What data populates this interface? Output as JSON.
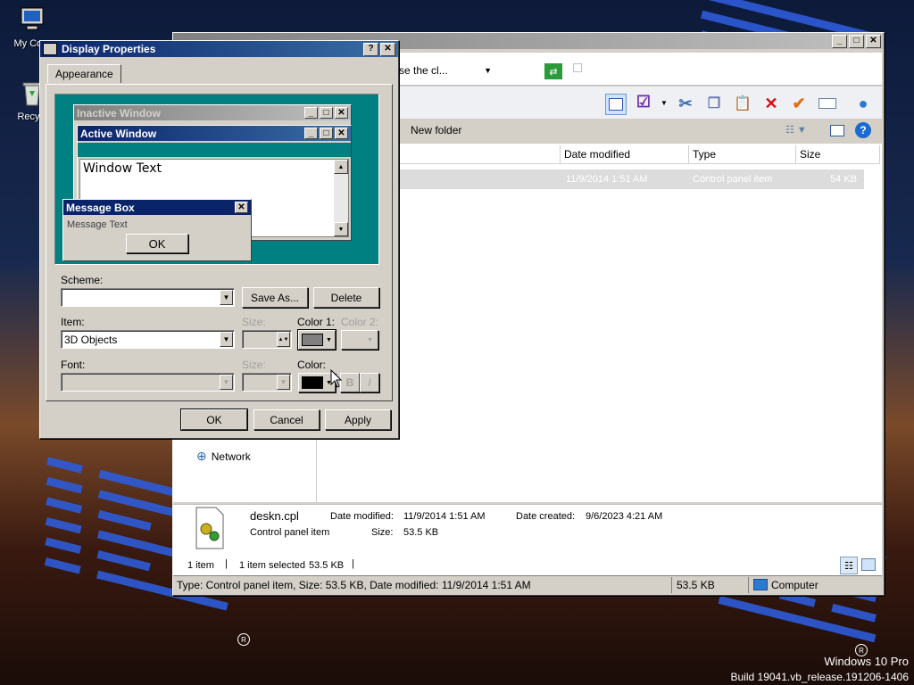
{
  "desktop": {
    "icons": [
      {
        "label": "My Com"
      },
      {
        "label": "Recycl"
      }
    ],
    "watermark": {
      "line1": "Windows 10 Pro",
      "line2": "Build 19041.vb_release.191206-1406"
    }
  },
  "explorer": {
    "address_text": "se the cl...",
    "new_folder_label": "New folder",
    "columns": [
      "Date modified",
      "Type",
      "Size"
    ],
    "row": {
      "date_modified": "11/9/2014 1:51 AM",
      "type": "Control panel item",
      "size": "54 KB"
    },
    "nav_network": "Network",
    "details": {
      "filename": "deskn.cpl",
      "kind": "Control panel item",
      "date_modified_label": "Date modified:",
      "date_modified": "11/9/2014 1:51 AM",
      "date_created_label": "Date created:",
      "date_created": "9/6/2023 4:21 AM",
      "size_label": "Size:",
      "size": "53.5 KB"
    },
    "status": {
      "items": "1 item",
      "selected": "1 item selected",
      "selected_size": "53.5 KB"
    },
    "statusbar2": {
      "text": "Type: Control panel item, Size: 53.5 KB, Date modified: 11/9/2014 1:51 AM",
      "size": "53.5 KB",
      "zone": "Computer"
    }
  },
  "dialog": {
    "title": "Display Properties",
    "tab": "Appearance",
    "preview": {
      "inactive_title": "Inactive Window",
      "active_title": "Active Window",
      "window_text": "Window Text",
      "msgbox_title": "Message Box",
      "msgbox_text": "Message Text",
      "ok": "OK"
    },
    "scheme_label": "Scheme:",
    "scheme_value": "",
    "save_as": "Save As...",
    "delete": "Delete",
    "item_label": "Item:",
    "item_value": "3D Objects",
    "size_label": "Size:",
    "color1_label": "Color 1:",
    "color2_label": "Color 2:",
    "font_label": "Font:",
    "font_size_label": "Size:",
    "font_color_label": "Color:",
    "bold": "B",
    "italic": "I",
    "buttons": {
      "ok": "OK",
      "cancel": "Cancel",
      "apply": "Apply"
    },
    "colors": {
      "color1": "#808080",
      "font_color": "#000000",
      "preview_bg": "#008080"
    }
  }
}
